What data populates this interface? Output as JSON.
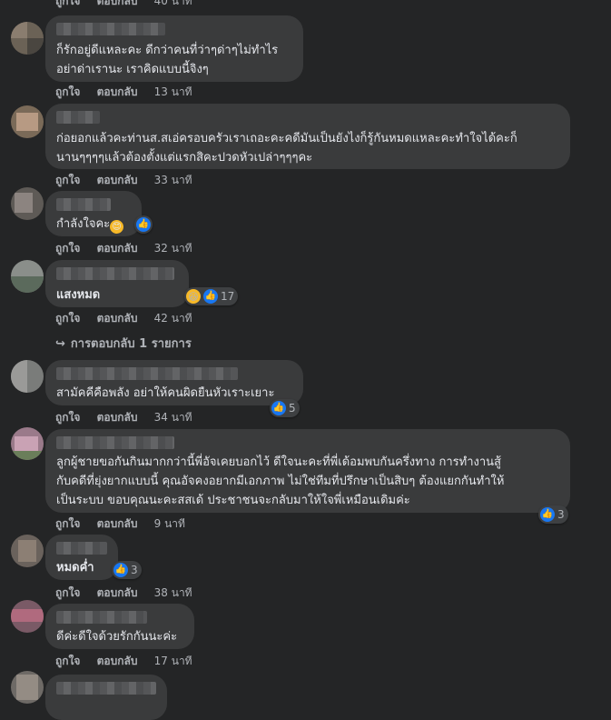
{
  "actions": {
    "like": "ถูกใจ",
    "reply": "ตอบกลับ"
  },
  "colors": {
    "background": "#242526",
    "bubble": "#3a3b3c",
    "like_blue": "#1877f2",
    "muted": "#b0b3b8"
  },
  "top_partial": {
    "like": "ถูกใจ",
    "reply": "ตอบกลับ",
    "time": "40 นาที"
  },
  "comments": [
    {
      "text": "ก็รักอยู่ดีแหละคะ ดีกว่าคนที่ว่าๆด่าๆไม่ทำไร\nอย่าด่าเรานะ เราคิดแบบนี้จิงๆ",
      "time": "13 นาที"
    },
    {
      "text": "ก่อยอกแล้วคะท่านส.สเอ่ครอบครัวเราเถอะคะคดีมันเป็นยังไงก็รู้กันหมดแหละคะทำใจได้คะก็\nนานๆๆๆๆแล้วต้องตั้งแต่แรกสิคะปวดหัวเปล่าๆๆๆคะ",
      "time": "33 นาที"
    },
    {
      "text": "กำลังใจคะ",
      "emoji": "😊",
      "time": "32 นาที",
      "reaction_icons": [
        "like-icon"
      ]
    },
    {
      "text": "แสงหมด",
      "time": "42 นาที",
      "reaction_icons": [
        "haha-icon",
        "like-icon"
      ],
      "reaction_count": "17"
    },
    {
      "text": "สามัคคีคือพลัง อย่าให้คนผิดยืนหัวเราะเยาะ",
      "time": "34 นาที",
      "reaction_icons": [
        "like-icon"
      ],
      "reaction_count": "5"
    },
    {
      "text": "ลูกผู้ชายขอกันกินมากกว่านี้พี่อัจเคยบอกไว้ ดีใจนะคะที่พี่เด้อมพบกันครึ่งทาง การทำงานสู้\nกับคดีที่ยุ่งยากแบบนี้ คุณอัจคงอยากมีเอกภาพ ไม่ใช่ทีมที่ปรึกษาเป็นสิบๆ ต้องแยกกันทำให้\nเป็นระบบ ขอบคุณนะคะสสเด้ ประชาชนจะกลับมาให้ใจพี่เหมือนเดิมค่ะ",
      "time": "9 นาที",
      "reaction_icons": [
        "like-icon"
      ],
      "reaction_count": "3"
    },
    {
      "text": "หมดค่ำ",
      "time": "38 นาที",
      "reaction_icons": [
        "like-icon"
      ],
      "reaction_count": "3"
    },
    {
      "text": "ดีค่ะดีใจด้วยรักกันนะค่ะ",
      "time": "17 นาที"
    }
  ],
  "replies_link": {
    "icon": "reply-arrow-icon",
    "label": "การตอบกลับ 1 รายการ"
  }
}
